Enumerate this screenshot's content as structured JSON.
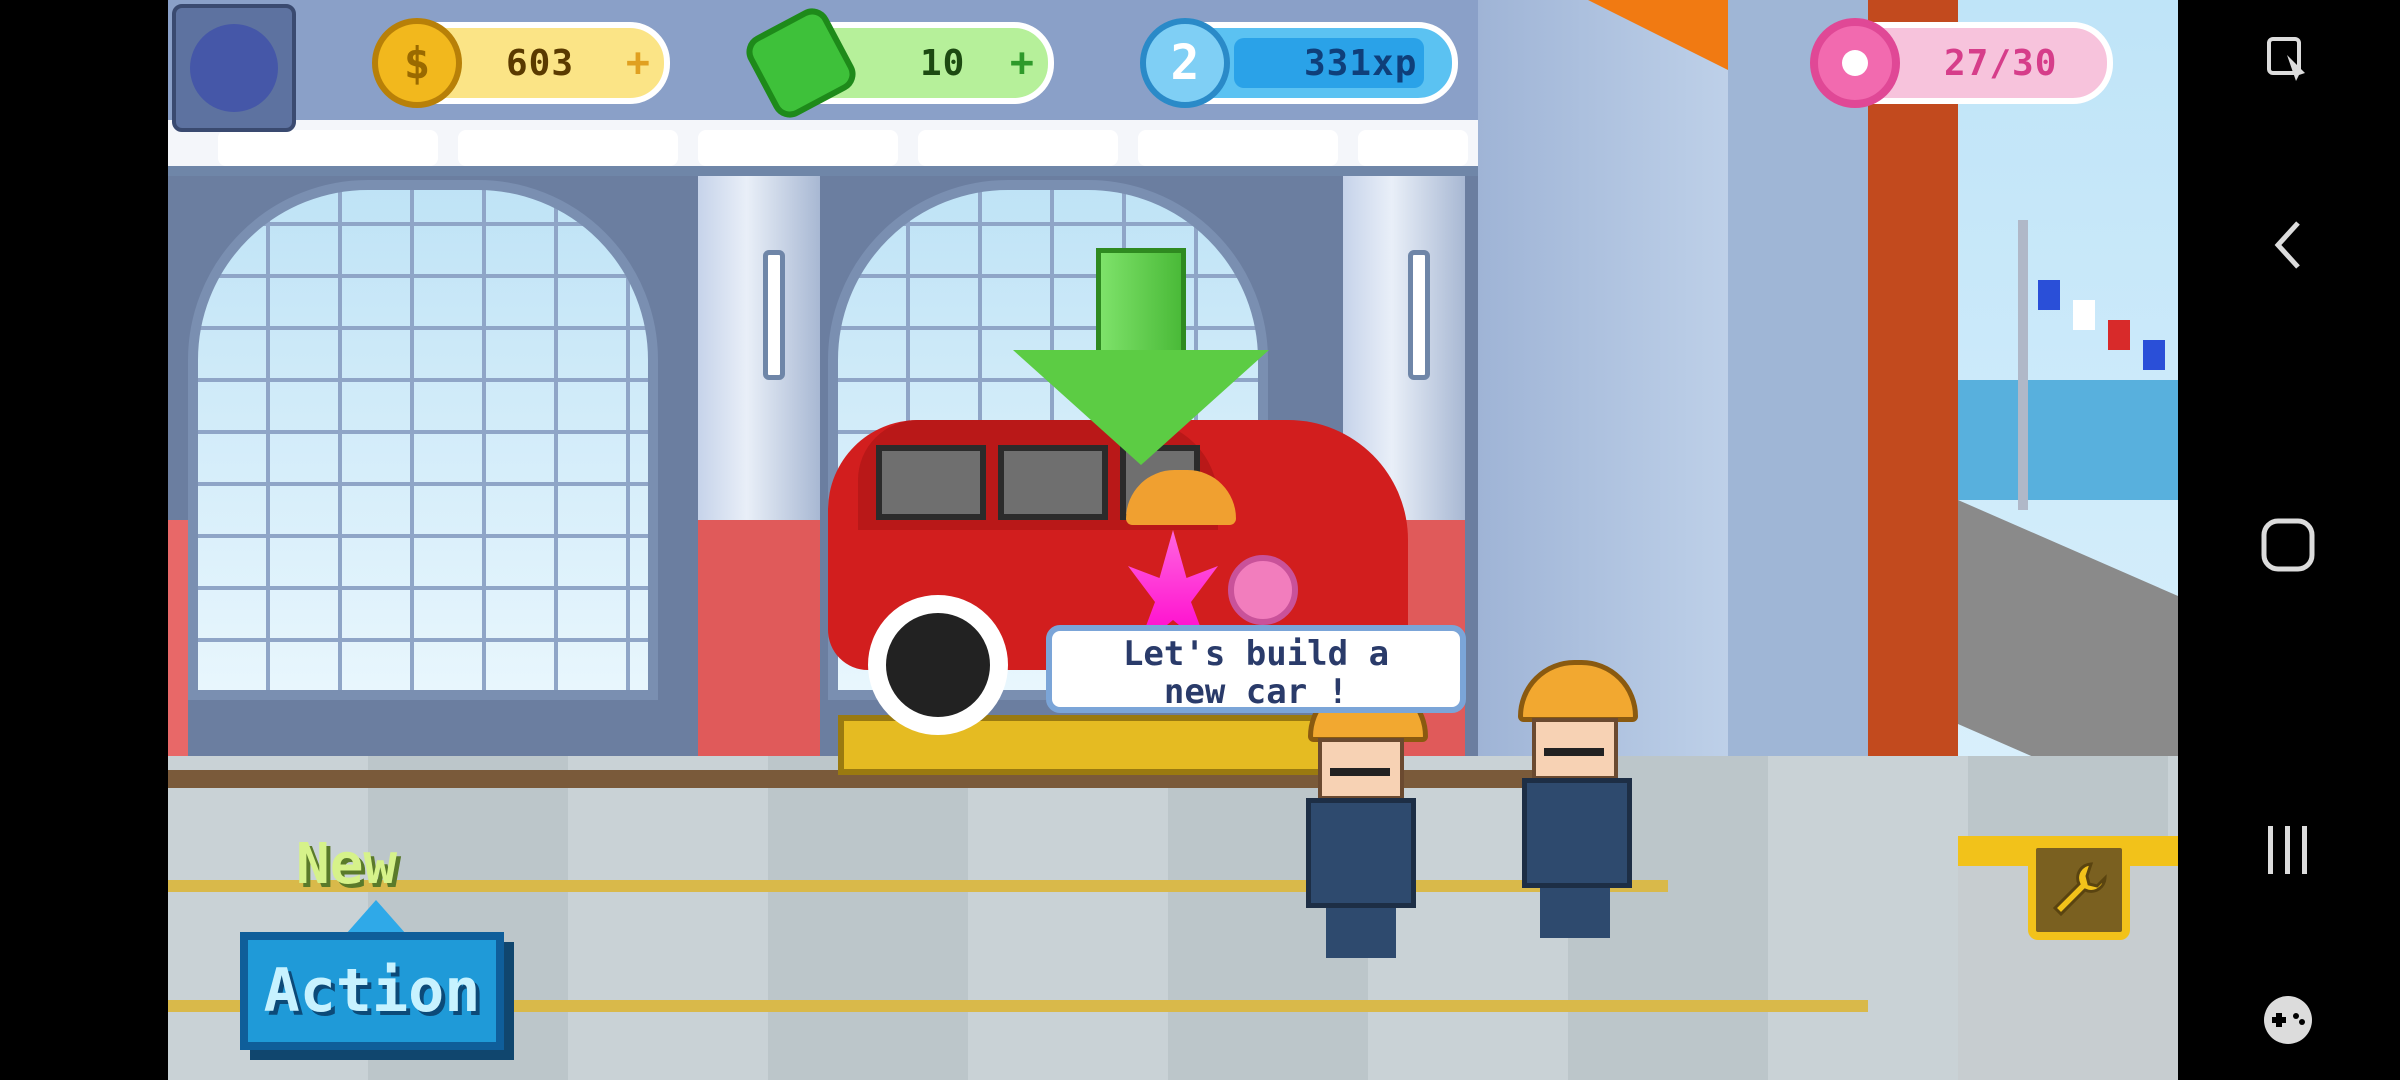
{
  "hud": {
    "coins": "603",
    "cash": "10",
    "level": "2",
    "xp": "331xp",
    "donuts": "27/30",
    "plus": "+"
  },
  "bubble": {
    "line1": "Let's build a",
    "line2": "new car !"
  },
  "new_action": {
    "new_label": "New",
    "action_label": "Action"
  },
  "colors": {
    "coin": "#f2b81d",
    "cash": "#3ec13a",
    "xp": "#2aa2e8",
    "donut": "#f26aaf",
    "action": "#1f9ad8"
  },
  "icons": {
    "menu": "menu-blob-icon",
    "coin": "coin-icon",
    "cash": "cash-icon",
    "xp": "xp-plane-icon",
    "donut": "donut-icon",
    "wrench": "wrench-icon",
    "down_arrow": "down-arrow-icon",
    "nav_screen_tool": "screen-tool-icon",
    "nav_back": "back-icon",
    "nav_home": "home-icon",
    "nav_recents": "recents-icon",
    "nav_game": "gamepad-icon"
  }
}
